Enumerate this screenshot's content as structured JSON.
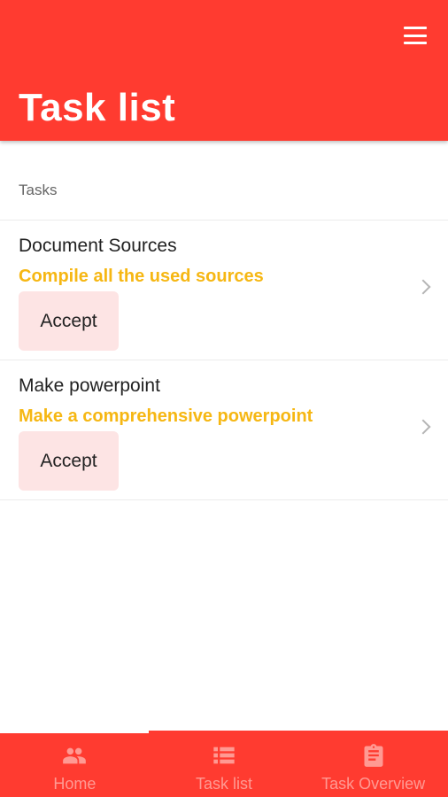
{
  "header": {
    "title": "Task list",
    "menu_icon": "hamburger-menu-icon",
    "color": "#ff3b30"
  },
  "section": {
    "label": "Tasks"
  },
  "tasks": [
    {
      "title": "Document Sources",
      "description": "Compile all the used sources",
      "accept_label": "Accept"
    },
    {
      "title": "Make powerpoint",
      "description": "Make a comprehensive powerpoint",
      "accept_label": "Accept"
    }
  ],
  "tabbar": {
    "tabs": [
      {
        "label": "Home",
        "icon": "people-icon"
      },
      {
        "label": "Task list",
        "icon": "list-icon"
      },
      {
        "label": "Task Overview",
        "icon": "clipboard-icon"
      }
    ],
    "active": "Home"
  },
  "colors": {
    "accent": "#ff3b30",
    "description": "#f6b713",
    "accept_bg": "#fde4e4"
  }
}
